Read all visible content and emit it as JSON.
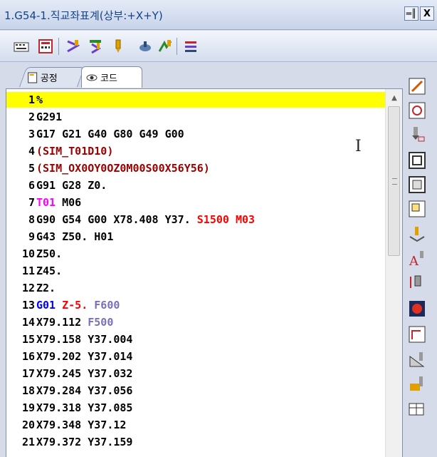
{
  "window": {
    "title": "1.G54-1.직교좌표계(상부:+X+Y)",
    "pin_label": "ㅁ",
    "close_label": "X"
  },
  "toolbar": {
    "buttons": [
      "keyboard-icon",
      "calculator-icon",
      "toolpath-icon",
      "tool-select-icon",
      "drill-icon",
      "measure-icon",
      "transform-icon",
      "list-icon"
    ]
  },
  "tabs": [
    {
      "label": "공정",
      "icon": "document-icon"
    },
    {
      "label": "코드",
      "icon": "eye-icon"
    }
  ],
  "colors": {
    "highlight": "#ffff00",
    "default": "#000000",
    "comment": "#990000",
    "tool": "#ff00ff",
    "spindle": "#ff0000",
    "gcode": "#0000ff",
    "feed": "#7a6fb8",
    "z_move": "#ff0000"
  },
  "lines": [
    {
      "n": "1",
      "segments": [
        {
          "t": "%",
          "c": "default"
        }
      ],
      "highlight": true
    },
    {
      "n": "2",
      "segments": [
        {
          "t": "G291",
          "c": "default"
        }
      ]
    },
    {
      "n": "3",
      "segments": [
        {
          "t": "G17 G21 G40 G80 G49 G00",
          "c": "default"
        }
      ]
    },
    {
      "n": "4",
      "segments": [
        {
          "t": "(SIM_T01D10)",
          "c": "comment"
        }
      ]
    },
    {
      "n": "5",
      "segments": [
        {
          "t": "(SIM_OX0OY0OZ0M00S00X56Y56)",
          "c": "comment"
        }
      ]
    },
    {
      "n": "6",
      "segments": [
        {
          "t": "G91 G28 Z0.",
          "c": "default"
        }
      ]
    },
    {
      "n": "7",
      "segments": [
        {
          "t": "T01",
          "c": "tool"
        },
        {
          "t": " M06",
          "c": "default"
        }
      ]
    },
    {
      "n": "8",
      "segments": [
        {
          "t": "G90 G54 G00 X78.408 Y37. ",
          "c": "default"
        },
        {
          "t": "S1500 M03",
          "c": "spindle"
        }
      ]
    },
    {
      "n": "9",
      "segments": [
        {
          "t": "G43 Z50. H01",
          "c": "default"
        }
      ]
    },
    {
      "n": "10",
      "segments": [
        {
          "t": "Z50.",
          "c": "default"
        }
      ]
    },
    {
      "n": "11",
      "segments": [
        {
          "t": "Z45.",
          "c": "default"
        }
      ]
    },
    {
      "n": "12",
      "segments": [
        {
          "t": "Z2.",
          "c": "default"
        }
      ]
    },
    {
      "n": "13",
      "segments": [
        {
          "t": "G01",
          "c": "gcode"
        },
        {
          "t": " Z-5.",
          "c": "z_move"
        },
        {
          "t": " F600",
          "c": "feed"
        }
      ]
    },
    {
      "n": "14",
      "segments": [
        {
          "t": "X79.112 ",
          "c": "default"
        },
        {
          "t": "F500",
          "c": "feed"
        }
      ]
    },
    {
      "n": "15",
      "segments": [
        {
          "t": "X79.158 Y37.004",
          "c": "default"
        }
      ]
    },
    {
      "n": "16",
      "segments": [
        {
          "t": "X79.202 Y37.014",
          "c": "default"
        }
      ]
    },
    {
      "n": "17",
      "segments": [
        {
          "t": "X79.245 Y37.032",
          "c": "default"
        }
      ]
    },
    {
      "n": "18",
      "segments": [
        {
          "t": "X79.284 Y37.056",
          "c": "default"
        }
      ]
    },
    {
      "n": "19",
      "segments": [
        {
          "t": "X79.318 Y37.085",
          "c": "default"
        }
      ]
    },
    {
      "n": "20",
      "segments": [
        {
          "t": "X79.348 Y37.12",
          "c": "default"
        }
      ]
    },
    {
      "n": "21",
      "segments": [
        {
          "t": "X79.372 Y37.159",
          "c": "default"
        }
      ]
    }
  ],
  "sidebar": {
    "buttons": [
      "arrow-icon",
      "rotate-icon",
      "tool-down-icon",
      "frame-icon",
      "frame-inner-icon",
      "copy-icon",
      "probe-icon",
      "text-tool-icon",
      "tool-length-icon",
      "gear-red-icon",
      "edge-icon",
      "angle-icon",
      "mill-icon",
      "table-icon"
    ]
  }
}
